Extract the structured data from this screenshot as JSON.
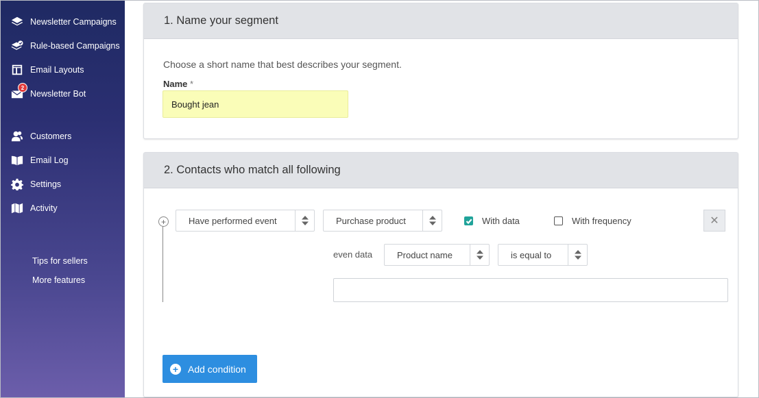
{
  "sidebar": {
    "items": [
      {
        "label": "Newsletter Campaigns",
        "icon": "layers-icon"
      },
      {
        "label": "Rule-based Campaigns",
        "icon": "rule-layers-icon"
      },
      {
        "label": "Email Layouts",
        "icon": "layout-icon"
      },
      {
        "label": "Newsletter Bot",
        "icon": "envelope-icon",
        "badge": "2"
      },
      {
        "label": "Customers",
        "icon": "users-icon"
      },
      {
        "label": "Email Log",
        "icon": "book-icon"
      },
      {
        "label": "Settings",
        "icon": "gear-icon"
      },
      {
        "label": "Activity",
        "icon": "map-icon"
      }
    ],
    "links": [
      "Tips for sellers",
      "More features"
    ]
  },
  "section1": {
    "title": "1. Name your segment",
    "description": "Choose a short name that best describes your segment.",
    "name_label": "Name",
    "required_marker": "*",
    "name_value": "Bought jean"
  },
  "section2": {
    "title": "2. Contacts who match all following",
    "event_select": "Have performed event",
    "action_select": "Purchase product",
    "with_data_label": "With data",
    "with_data_checked": true,
    "with_frequency_label": "With frequency",
    "with_frequency_checked": false,
    "remove_symbol": "✕",
    "even_data_label": "even data",
    "field_select": "Product name",
    "operator_select": "is equal to",
    "value_input": "",
    "add_condition_label": "Add condition"
  },
  "colors": {
    "sidebar_top": "#1f2a63",
    "sidebar_bottom": "#6c5eab",
    "name_input_bg": "#fafdb8",
    "checkbox_checked": "#20a39a",
    "primary_button": "#2d8ee0"
  }
}
